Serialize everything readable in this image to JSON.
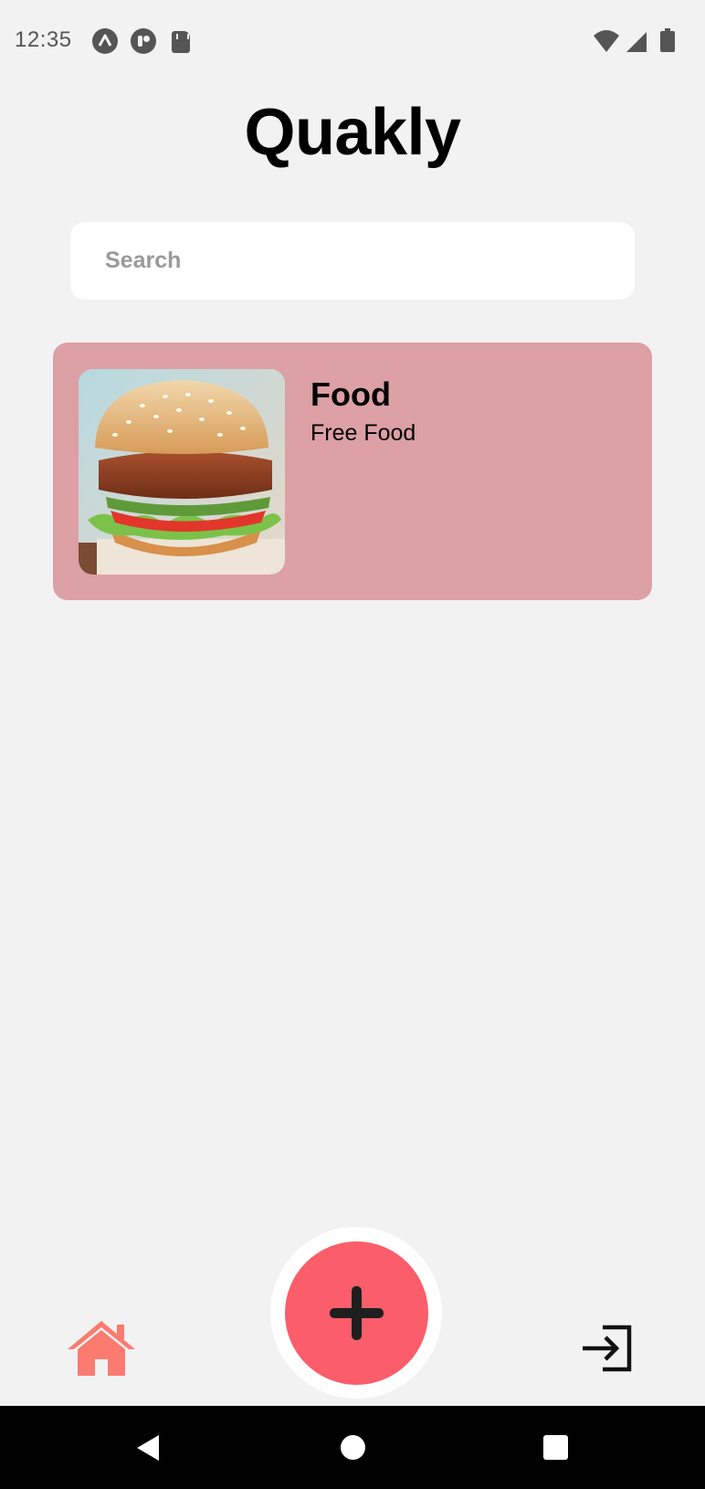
{
  "status_bar": {
    "time": "12:35",
    "left_icons": [
      "notification-a-icon",
      "notification-circle-icon",
      "sd-card-icon"
    ],
    "right_icons": [
      "wifi-icon",
      "signal-icon",
      "battery-icon"
    ]
  },
  "app": {
    "title": "Quakly"
  },
  "search": {
    "placeholder": "Search",
    "value": ""
  },
  "items": [
    {
      "title": "Food",
      "subtitle": "Free Food",
      "image": "burger-image",
      "background_color": "#dca0a5"
    }
  ],
  "bottom_nav": {
    "home_icon": "home-icon",
    "add_icon": "plus-icon",
    "login_icon": "login-icon",
    "accent_color": "#fb5d6a"
  },
  "system_nav": {
    "buttons": [
      "back",
      "home",
      "recents"
    ]
  }
}
